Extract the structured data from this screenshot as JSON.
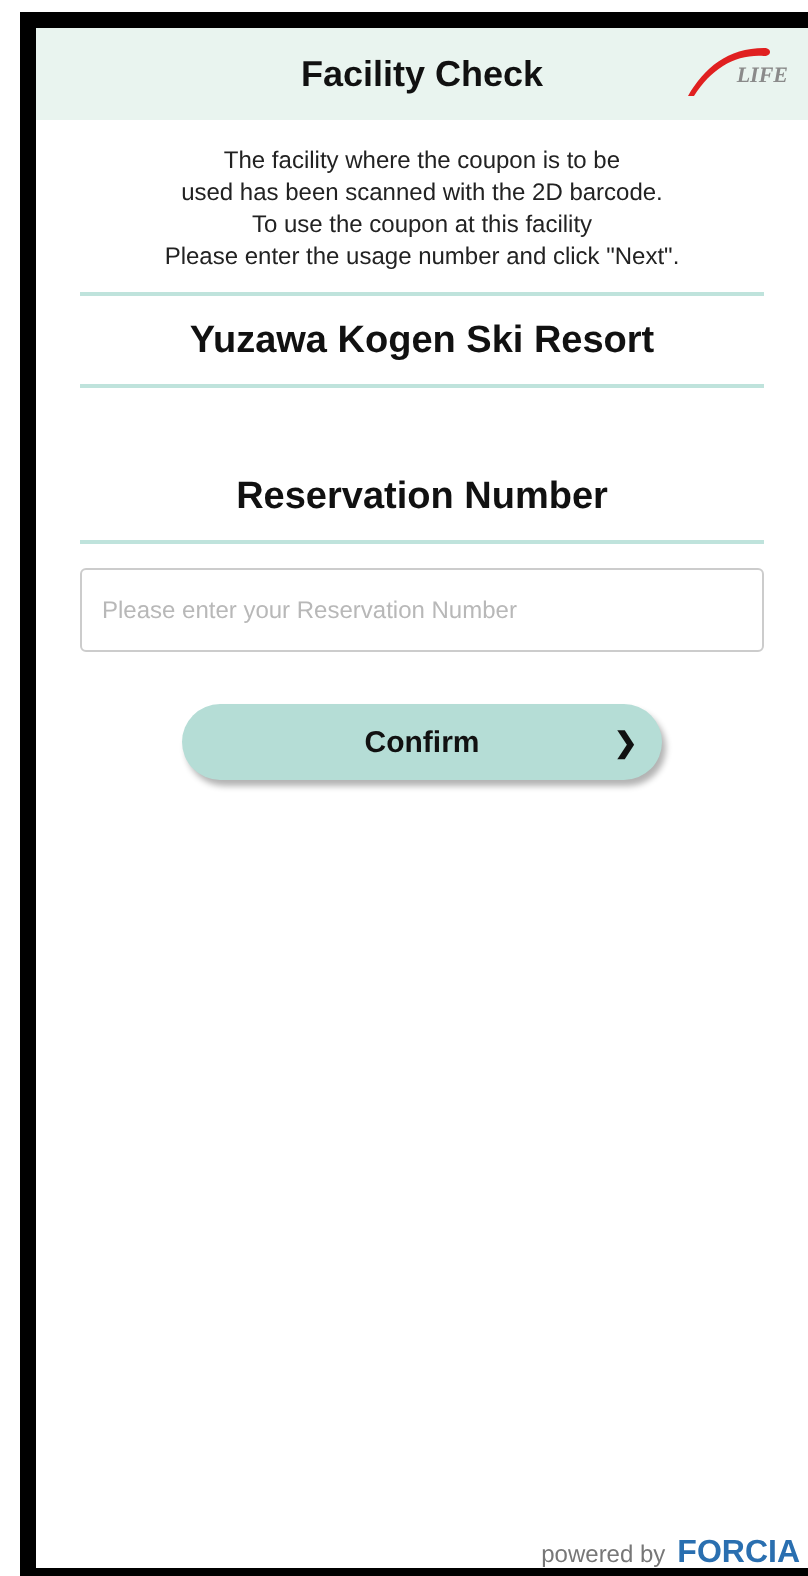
{
  "header": {
    "title": "Facility Check",
    "logo_text": "LIFE"
  },
  "instructions": [
    "The facility where the coupon is to be",
    "used has been scanned with the 2D barcode.",
    "To use the coupon at this facility",
    "Please enter the usage number and click \"Next\"."
  ],
  "facility_name": "Yuzawa Kogen Ski Resort",
  "reservation": {
    "heading": "Reservation Number",
    "placeholder": "Please enter your Reservation Number"
  },
  "confirm_button": {
    "label": "Confirm",
    "arrow": "❯"
  },
  "footer": {
    "powered_by": "powered by",
    "brand": "FORCIA"
  }
}
